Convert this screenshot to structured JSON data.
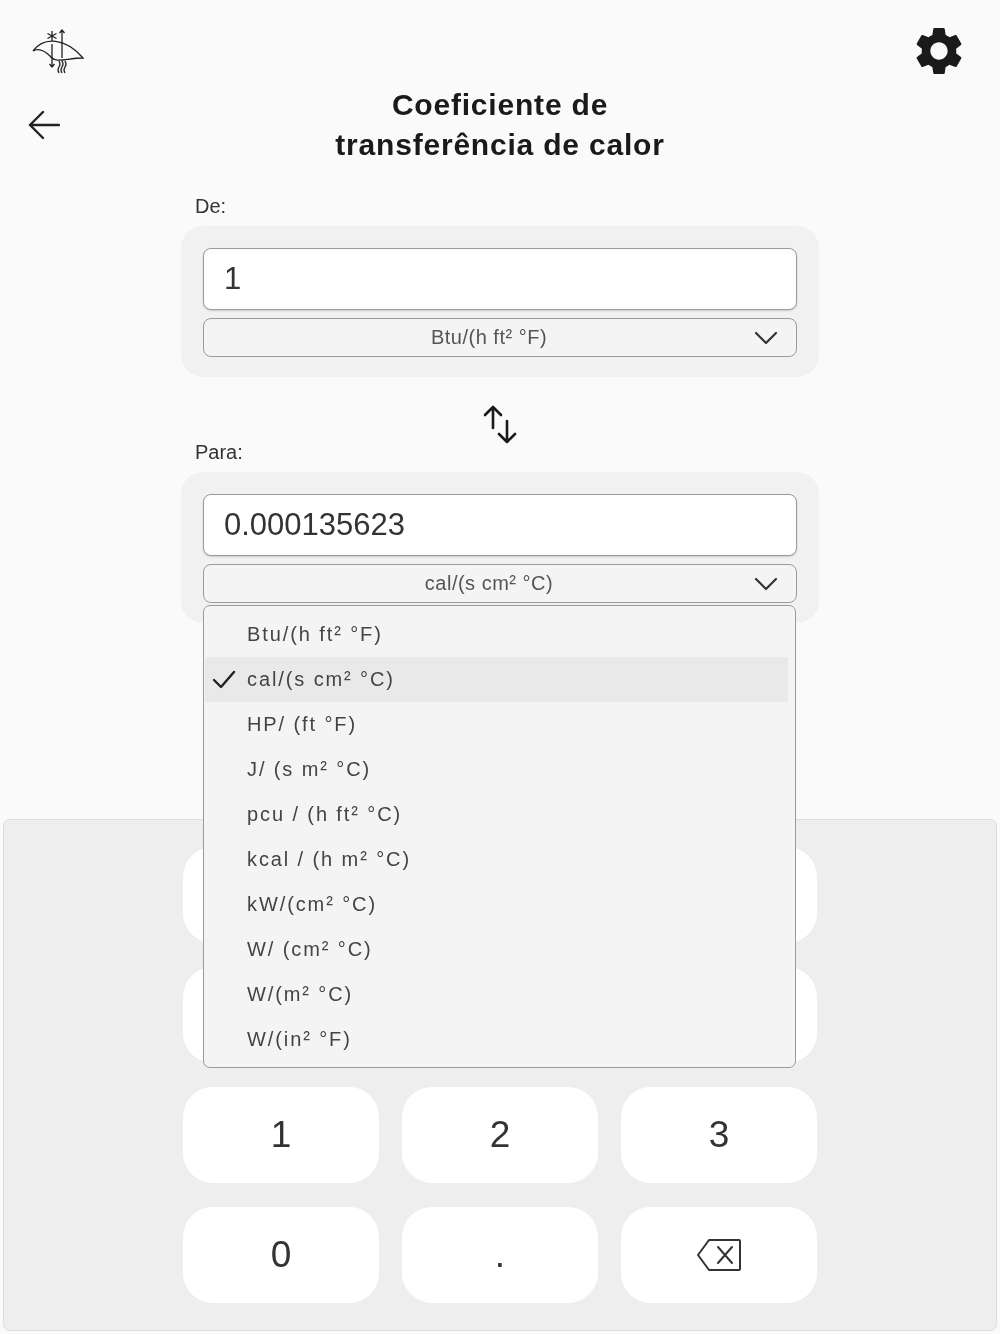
{
  "header": {
    "title": "Coeficiente de transferência de calor"
  },
  "from": {
    "label": "De:",
    "value": "1",
    "unit": "Btu/(h ft² °F)"
  },
  "to": {
    "label": "Para:",
    "value": "0.000135623",
    "unit": "cal/(s cm² °C)",
    "menu": [
      {
        "label": "Btu/(h ft² °F)",
        "selected": false
      },
      {
        "label": "cal/(s cm² °C)",
        "selected": true
      },
      {
        "label": "HP/ (ft °F)",
        "selected": false
      },
      {
        "label": "J/ (s m² °C)",
        "selected": false
      },
      {
        "label": "pcu / (h ft² °C)",
        "selected": false
      },
      {
        "label": "kcal / (h m² °C)",
        "selected": false
      },
      {
        "label": "kW/(cm² °C)",
        "selected": false
      },
      {
        "label": "W/ (cm² °C)",
        "selected": false
      },
      {
        "label": "W/(m² °C)",
        "selected": false
      },
      {
        "label": "W/(in² °F)",
        "selected": false
      }
    ]
  },
  "keypad": {
    "keys": [
      {
        "kind": "covered"
      },
      {
        "kind": "hidden"
      },
      {
        "kind": "covered"
      },
      {
        "kind": "covered"
      },
      {
        "kind": "hidden"
      },
      {
        "kind": "covered"
      },
      {
        "kind": "digit",
        "label": "1"
      },
      {
        "kind": "digit",
        "label": "2"
      },
      {
        "kind": "digit",
        "label": "3"
      },
      {
        "kind": "digit",
        "label": "0"
      },
      {
        "kind": "digit",
        "label": "."
      },
      {
        "kind": "backspace"
      }
    ]
  }
}
